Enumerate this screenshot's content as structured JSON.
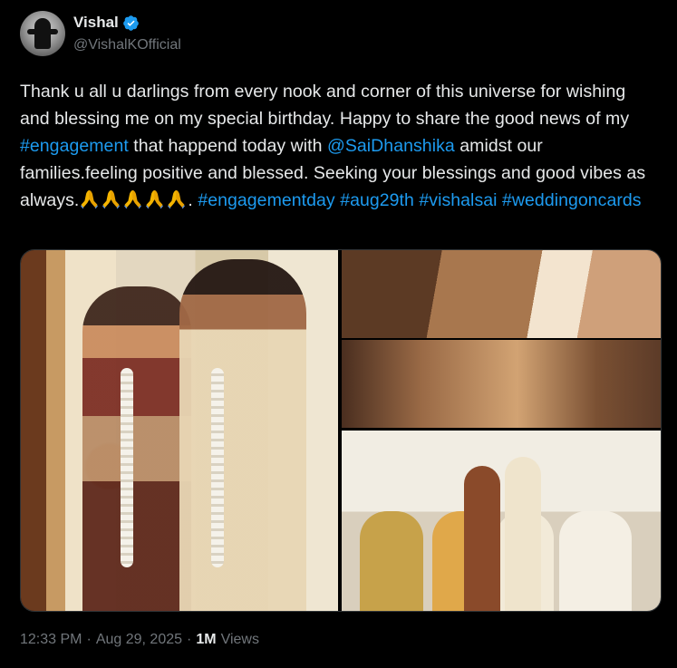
{
  "author": {
    "display_name": "Vishal",
    "handle": "@VishalKOfficial",
    "verified": true
  },
  "tweet": {
    "segments": [
      {
        "text": "Thank u all u darlings from every nook and corner of this universe for wishing and blessing me on my special birthday. Happy to share the good news of my ",
        "type": "text"
      },
      {
        "text": "#engagement",
        "type": "link"
      },
      {
        "text": " that happend today with ",
        "type": "text"
      },
      {
        "text": "@SaiDhanshika",
        "type": "link"
      },
      {
        "text": " amidst our families.feeling positive and blessed. Seeking your blessings and good vibes as always.",
        "type": "text"
      },
      {
        "text": ".  ",
        "type": "text"
      },
      {
        "text": "#engagementday",
        "type": "link"
      },
      {
        "text": " ",
        "type": "text"
      },
      {
        "text": "#aug29th",
        "type": "link"
      },
      {
        "text": " ",
        "type": "text"
      },
      {
        "text": "#vishalsai",
        "type": "link"
      },
      {
        "text": " ",
        "type": "text"
      },
      {
        "text": "#weddingoncards",
        "type": "link"
      }
    ],
    "emoji_count": 5,
    "emoji": "folded-hands"
  },
  "media": {
    "images": [
      {
        "name": "couple-photo"
      },
      {
        "name": "ring-closeup-1"
      },
      {
        "name": "ring-closeup-2"
      },
      {
        "name": "family-photo"
      }
    ]
  },
  "meta": {
    "time": "12:33 PM",
    "separator": "·",
    "date": "Aug 29, 2025",
    "views_count": "1M",
    "views_label": "Views"
  },
  "colors": {
    "background": "#000000",
    "text": "#e7e9ea",
    "secondary": "#71767b",
    "link": "#1d9bf0",
    "border": "#2f3336"
  }
}
